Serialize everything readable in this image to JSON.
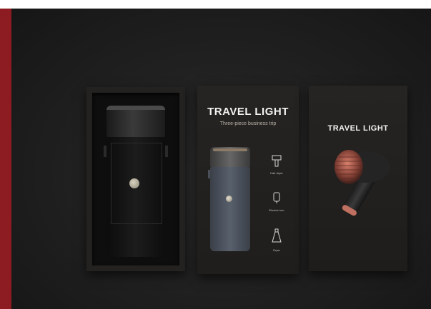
{
  "scene": {
    "accent_color": "#8c1c22",
    "background_color": "#1b1b1b"
  },
  "box_open": {
    "contents": "travel-device"
  },
  "box_front": {
    "title": "TRAVEL LIGHT",
    "subtitle": "Three-piece business trip",
    "features": [
      {
        "icon": "hair-dryer-icon",
        "label": "Hair dryer"
      },
      {
        "icon": "electric-iron-icon",
        "label": "Electric iron"
      },
      {
        "icon": "dryer-icon",
        "label": "Dryer"
      }
    ]
  },
  "box_side": {
    "title": "TRAVEL LIGHT"
  }
}
